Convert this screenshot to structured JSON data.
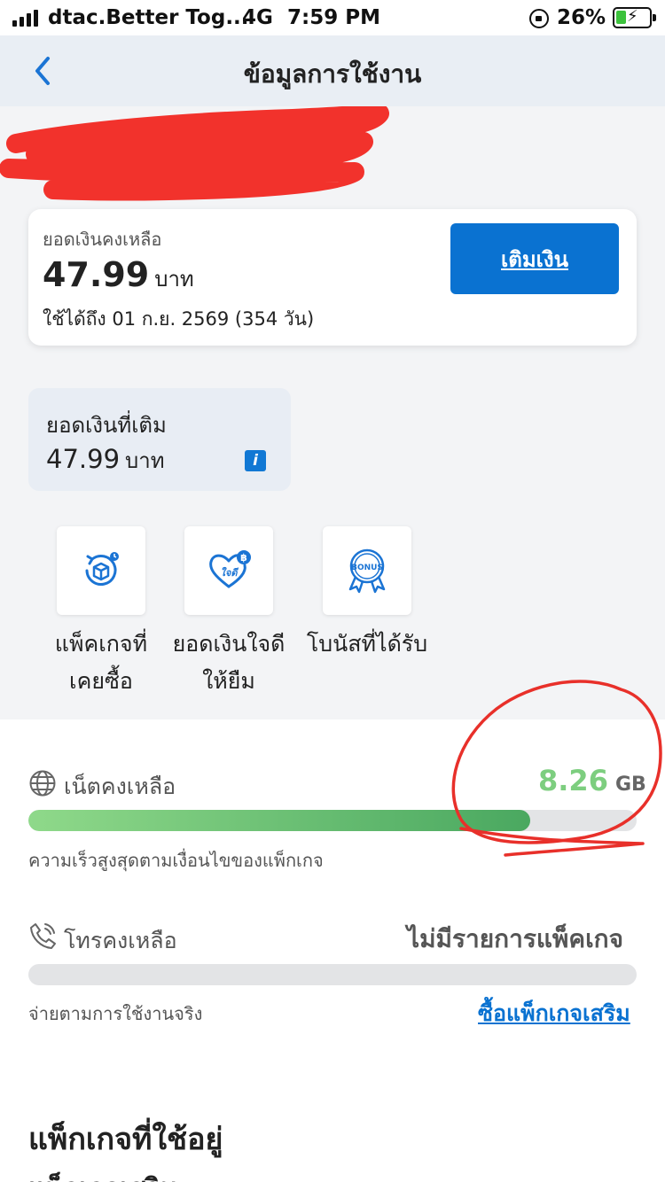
{
  "status_bar": {
    "carrier": "dtac.Better Tog...",
    "network": "4G",
    "time": "7:59 PM",
    "battery_percent": "26%",
    "battery_level": 0.26
  },
  "nav": {
    "title": "ข้อมูลการใช้งาน",
    "back_icon": "chevron-left-icon"
  },
  "balance": {
    "label": "ยอดเงินคงเหลือ",
    "amount": "47.99",
    "unit": "บาท",
    "valid_until": "ใช้ได้ถึง 01 ก.ย. 2569 (354 วัน)",
    "topup_label": "เติมเงิน"
  },
  "added": {
    "label": "ยอดเงินที่เติม",
    "amount": "47.99",
    "unit": "บาท",
    "info_icon": "info-icon"
  },
  "quick_actions": [
    {
      "label_line1": "แพ็คเกจที่",
      "label_line2": "เคยซื้อ",
      "icon": "package-history-icon"
    },
    {
      "label_line1": "ยอดเงินใจดี",
      "label_line2": "ให้ยืม",
      "icon": "heart-baht-icon",
      "icon_text": "ใจดี"
    },
    {
      "label_line1": "โบนัสที่ได้รับ",
      "label_line2": "",
      "icon": "bonus-ribbon-icon",
      "icon_text": "BONUS"
    }
  ],
  "internet": {
    "label": "เน็ตคงเหลือ",
    "value": "8.26",
    "unit": "GB",
    "fill_fraction": 0.825,
    "note": "ความเร็วสูงสุดตามเงื่อนไขของแพ็กเกจ",
    "icon": "globe-icon"
  },
  "voice": {
    "label": "โทรคงเหลือ",
    "status": "ไม่มีรายการแพ็คเกจ",
    "fill_fraction": 0,
    "note": "จ่ายตามการใช้งานจริง",
    "link": "ซื้อแพ็กเกจเสริม",
    "icon": "phone-icon"
  },
  "packages": {
    "title": "แพ็กเกจที่ใช้อยู่",
    "subtitle": "แพ็กเกจเสริม"
  },
  "colors": {
    "accent": "#0a72d1",
    "data_green": "#7dce7f",
    "annotation_red": "#e8302a"
  }
}
